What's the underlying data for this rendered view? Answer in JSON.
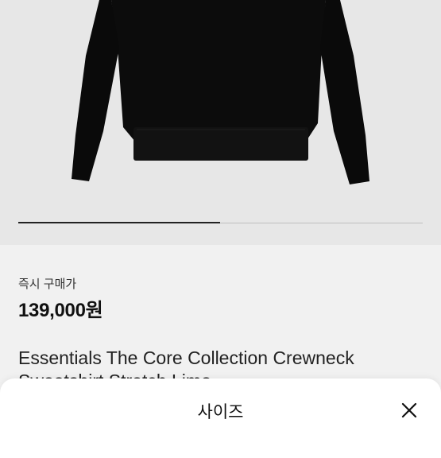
{
  "product": {
    "image_icon": "sweatshirt-image",
    "carousel_progress": 0.5
  },
  "price": {
    "label": "즉시 구매가",
    "value": "139,000원"
  },
  "title_lines": [
    "Essentials The Core Collection Crewneck",
    "Sweatshirt Stretch Limo"
  ],
  "sheet": {
    "title": "사이즈",
    "close_icon": "close-icon"
  }
}
